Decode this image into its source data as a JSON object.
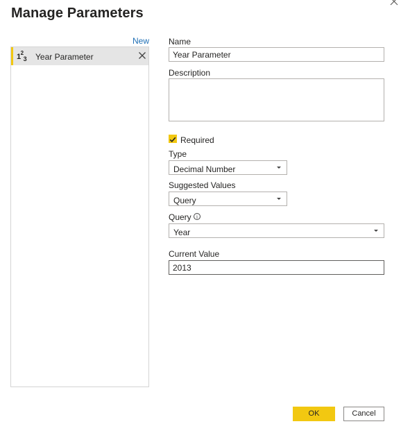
{
  "dialog": {
    "title": "Manage Parameters"
  },
  "list": {
    "new_label": "New",
    "items": [
      {
        "icon": "number-type-icon",
        "label": "Year Parameter"
      }
    ]
  },
  "form": {
    "name_label": "Name",
    "name_value": "Year Parameter",
    "description_label": "Description",
    "description_value": "",
    "required_label": "Required",
    "required_checked": true,
    "type_label": "Type",
    "type_value": "Decimal Number",
    "suggested_label": "Suggested Values",
    "suggested_value": "Query",
    "query_label": "Query",
    "query_value": "Year",
    "current_label": "Current Value",
    "current_value": "2013"
  },
  "buttons": {
    "ok": "OK",
    "cancel": "Cancel"
  },
  "colors": {
    "accent": "#f2c811",
    "link": "#1f6fb5"
  }
}
